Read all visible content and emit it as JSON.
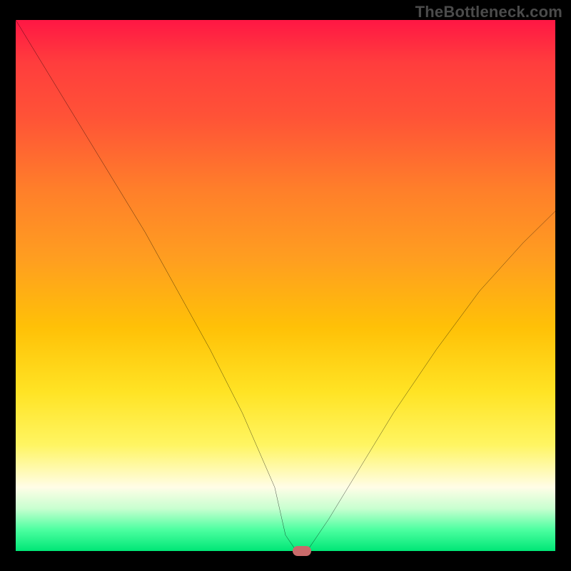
{
  "watermark": "TheBottleneck.com",
  "chart_data": {
    "type": "line",
    "title": "",
    "xlabel": "",
    "ylabel": "",
    "xlim": [
      0,
      100
    ],
    "ylim": [
      0,
      100
    ],
    "series": [
      {
        "name": "bottleneck-curve",
        "x": [
          0,
          6,
          12,
          18,
          24,
          30,
          36,
          42,
          48,
          50,
          52,
          54,
          58,
          64,
          70,
          78,
          86,
          94,
          100
        ],
        "values": [
          100,
          90,
          80,
          70,
          60,
          49,
          38,
          26,
          12,
          3,
          0,
          0,
          6,
          16,
          26,
          38,
          49,
          58,
          64
        ]
      }
    ],
    "marker": {
      "x": 53,
      "y": 0,
      "name": "optimal-point"
    },
    "background": {
      "type": "vertical-gradient",
      "stops": [
        {
          "pos": 0.0,
          "color": "#ff1744"
        },
        {
          "pos": 0.3,
          "color": "#ff7f2a"
        },
        {
          "pos": 0.6,
          "color": "#ffc107"
        },
        {
          "pos": 0.85,
          "color": "#fffde7"
        },
        {
          "pos": 1.0,
          "color": "#00e676"
        }
      ]
    }
  }
}
